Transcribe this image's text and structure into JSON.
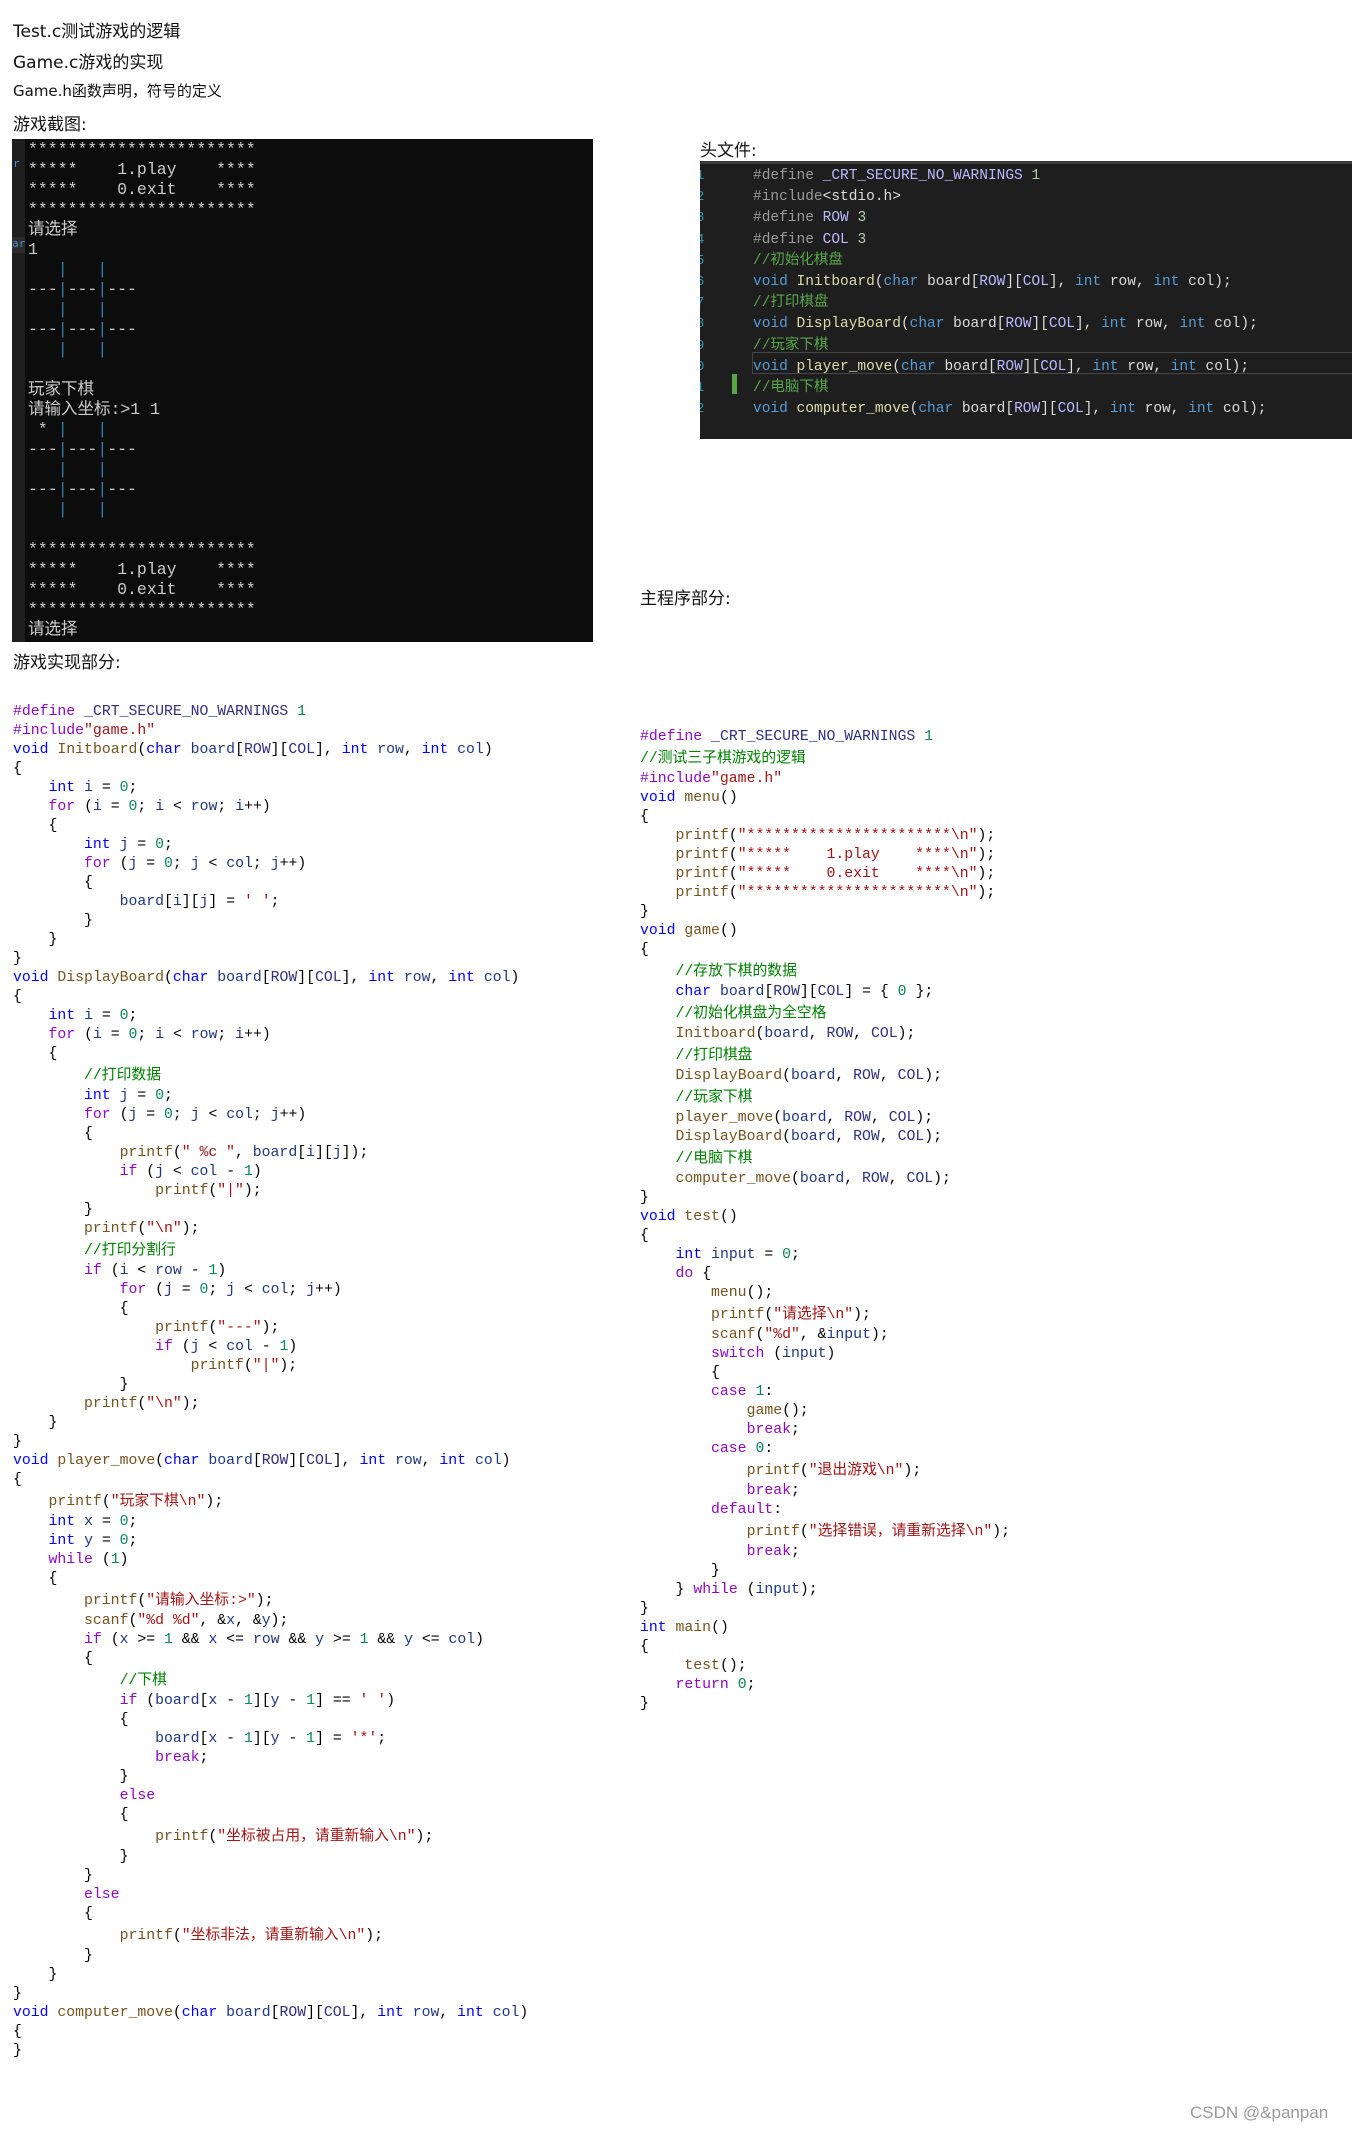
{
  "notes": {
    "test_c": "Test.c测试游戏的逻辑",
    "game_c": "Game.c游戏的实现",
    "game_h": "Game.h函数声明，符号的定义",
    "screenshot_label": "游戏截图:"
  },
  "sections": {
    "header_file": "头文件:",
    "main_program": "主程序部分:",
    "game_impl": "游戏实现部分:"
  },
  "terminal": {
    "gutter_fragments": [
      "r",
      "ar"
    ],
    "lines": [
      "***********************",
      "*****    1.play    ****",
      "*****    0.exit    ****",
      "***********************",
      "请选择",
      "1",
      "   |   |   ",
      "---|---|---",
      "   |   |   ",
      "---|---|---",
      "   |   |   ",
      "",
      "玩家下棋",
      "请输入坐标:>1 1",
      " * |   |   ",
      "---|---|---",
      "   |   |   ",
      "---|---|---",
      "   |   |   ",
      "",
      "***********************",
      "*****    1.play    ****",
      "*****    0.exit    ****",
      "***********************",
      "请选择"
    ]
  },
  "header_code": {
    "line_numbers": [
      "1",
      "2",
      "3",
      "4",
      "5",
      "6",
      "7",
      "8",
      "9",
      "0",
      "1",
      "2"
    ],
    "lines": [
      "#define _CRT_SECURE_NO_WARNINGS 1",
      "#include<stdio.h>",
      "#define ROW 3",
      "#define COL 3",
      "//初始化棋盘",
      "void Initboard(char board[ROW][COL], int row, int col);",
      "//打印棋盘",
      "void DisplayBoard(char board[ROW][COL], int row, int col);",
      "//玩家下棋",
      "void player_move(char board[ROW][COL], int row, int col);",
      "//电脑下棋",
      "void computer_move(char board[ROW][COL], int row, int col);"
    ]
  },
  "game_code": {
    "lines": [
      "#define _CRT_SECURE_NO_WARNINGS 1",
      "#include\"game.h\"",
      "void Initboard(char board[ROW][COL], int row, int col)",
      "{",
      "    int i = 0;",
      "    for (i = 0; i < row; i++)",
      "    {",
      "        int j = 0;",
      "        for (j = 0; j < col; j++)",
      "        {",
      "            board[i][j] = ' ';",
      "        }",
      "    }",
      "}",
      "void DisplayBoard(char board[ROW][COL], int row, int col)",
      "{",
      "    int i = 0;",
      "    for (i = 0; i < row; i++)",
      "    {",
      "        //打印数据",
      "        int j = 0;",
      "        for (j = 0; j < col; j++)",
      "        {",
      "            printf(\" %c \", board[i][j]);",
      "            if (j < col - 1)",
      "                printf(\"|\");",
      "        }",
      "        printf(\"\\n\");",
      "        //打印分割行",
      "        if (i < row - 1)",
      "            for (j = 0; j < col; j++)",
      "            {",
      "                printf(\"---\");",
      "                if (j < col - 1)",
      "                    printf(\"|\");",
      "            }",
      "        printf(\"\\n\");",
      "    }",
      "}",
      "void player_move(char board[ROW][COL], int row, int col)",
      "{",
      "    printf(\"玩家下棋\\n\");",
      "    int x = 0;",
      "    int y = 0;",
      "    while (1)",
      "    {",
      "        printf(\"请输入坐标:>\");",
      "        scanf(\"%d %d\", &x, &y);",
      "        if (x >= 1 && x <= row && y >= 1 && y <= col)",
      "        {",
      "            //下棋",
      "            if (board[x - 1][y - 1] == ' ')",
      "            {",
      "                board[x - 1][y - 1] = '*';",
      "                break;",
      "            }",
      "            else",
      "            {",
      "                printf(\"坐标被占用，请重新输入\\n\");",
      "            }",
      "        }",
      "        else",
      "        {",
      "            printf(\"坐标非法，请重新输入\\n\");",
      "        }",
      "    }",
      "}",
      "void computer_move(char board[ROW][COL], int row, int col)",
      "{",
      "}"
    ]
  },
  "main_code": {
    "lines": [
      "#define _CRT_SECURE_NO_WARNINGS 1",
      "//测试三子棋游戏的逻辑",
      "#include\"game.h\"",
      "void menu()",
      "{",
      "    printf(\"***********************\\n\");",
      "    printf(\"*****    1.play    ****\\n\");",
      "    printf(\"*****    0.exit    ****\\n\");",
      "    printf(\"***********************\\n\");",
      "}",
      "void game()",
      "{",
      "    //存放下棋的数据",
      "    char board[ROW][COL] = { 0 };",
      "    //初始化棋盘为全空格",
      "    Initboard(board, ROW, COL);",
      "    //打印棋盘",
      "    DisplayBoard(board, ROW, COL);",
      "    //玩家下棋",
      "    player_move(board, ROW, COL);",
      "    DisplayBoard(board, ROW, COL);",
      "    //电脑下棋",
      "    computer_move(board, ROW, COL);",
      "}",
      "void test()",
      "{",
      "    int input = 0;",
      "    do {",
      "        menu();",
      "        printf(\"请选择\\n\");",
      "        scanf(\"%d\", &input);",
      "        switch (input)",
      "        {",
      "        case 1:",
      "            game();",
      "            break;",
      "        case 0:",
      "            printf(\"退出游戏\\n\");",
      "            break;",
      "        default:",
      "            printf(\"选择错误，请重新选择\\n\");",
      "            break;",
      "        }",
      "    } while (input);",
      "}",
      "int main()",
      "{",
      "     test();",
      "    return 0;",
      "}"
    ]
  },
  "watermark": "CSDN @&panpan",
  "colors": {
    "terminal_bg": "#0c0c0c",
    "editor_bg": "#1e1e1e",
    "keyword_light": "#0000ff",
    "comment_light": "#008000",
    "string_light": "#a31515",
    "change_bar": "#57a64a"
  }
}
